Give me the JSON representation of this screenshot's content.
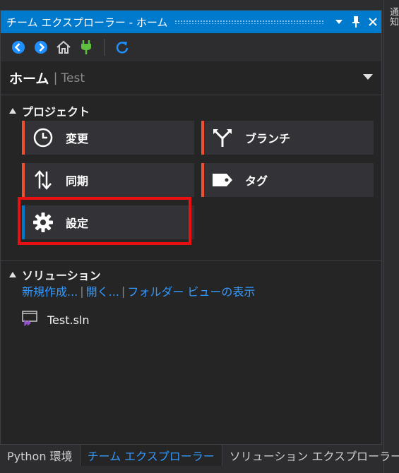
{
  "side_panel": {
    "label": "通知"
  },
  "window": {
    "title": "チーム エクスプローラー - ホーム",
    "title_buttons": [
      "chevron-down-icon",
      "pin-icon",
      "close-icon"
    ]
  },
  "toolbar": {
    "buttons": [
      "back-icon",
      "forward-icon",
      "home-icon",
      "connect-icon",
      "refresh-icon"
    ]
  },
  "header": {
    "page": "ホーム",
    "separator": "|",
    "project": "Test"
  },
  "project_section": {
    "title": "プロジェクト",
    "tiles": [
      {
        "label": "変更",
        "icon": "clock-icon",
        "accent": "#f05032"
      },
      {
        "label": "ブランチ",
        "icon": "branch-icon",
        "accent": "#f05032"
      },
      {
        "label": "同期",
        "icon": "sync-arrows-icon",
        "accent": "#f05032"
      },
      {
        "label": "タグ",
        "icon": "tag-icon",
        "accent": "#f05032"
      },
      {
        "label": "設定",
        "icon": "gear-icon",
        "accent": "#007acc"
      }
    ]
  },
  "solution_section": {
    "title": "ソリューション",
    "links": [
      "新規作成...",
      "開く...",
      "フォルダー ビューの表示"
    ],
    "link_separator": "|",
    "items": [
      {
        "name": "Test.sln",
        "icon": "solution-file-icon"
      }
    ]
  },
  "bottom_tabs": [
    {
      "label": "Python 環境",
      "active": false
    },
    {
      "label": "チーム エクスプローラー",
      "active": true
    },
    {
      "label": "ソリューション エクスプローラー",
      "active": false
    }
  ],
  "colors": {
    "title_bar": "#007acc",
    "accent_orange": "#f05032",
    "accent_blue": "#007acc",
    "link": "#3399ff",
    "highlight_box": "#e81010"
  }
}
